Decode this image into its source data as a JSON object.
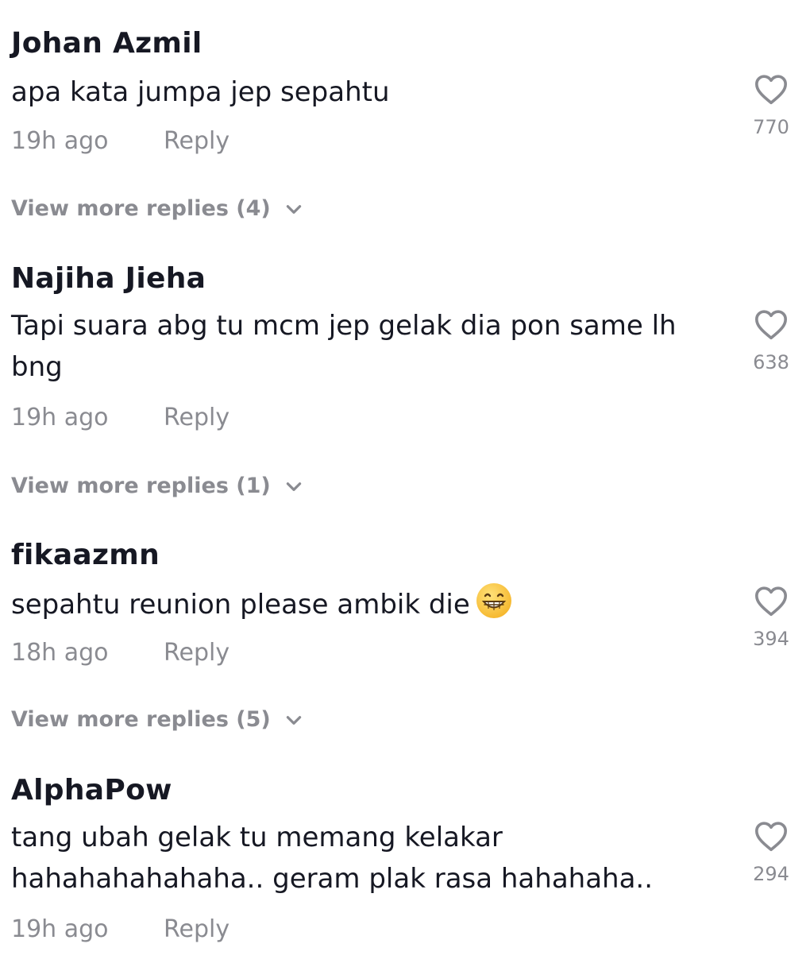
{
  "comments": [
    {
      "username": "Johan Azmil",
      "text": "apa kata jumpa jep sepahtu",
      "time": "19h ago",
      "reply_label": "Reply",
      "likes": "770",
      "view_more": "View more replies (4)"
    },
    {
      "username": "Najiha Jieha",
      "text": "Tapi suara abg tu mcm jep gelak dia pon same lh bng",
      "time": "19h ago",
      "reply_label": "Reply",
      "likes": "638",
      "view_more": "View more replies (1)"
    },
    {
      "username": "fikaazmn",
      "text": "sepahtu reunion please ambik die",
      "emoji": "grinning-face-emoji",
      "time": "18h ago",
      "reply_label": "Reply",
      "likes": "394",
      "view_more": "View more replies (5)"
    },
    {
      "username": "AlphaPow",
      "text": "tang ubah gelak tu memang kelakar hahahahahahaha.. geram plak rasa hahahaha..",
      "time": "19h ago",
      "reply_label": "Reply",
      "likes": "294"
    }
  ],
  "icons": {
    "like": "heart-outline-icon",
    "expand": "chevron-down-icon"
  },
  "colors": {
    "username": "#161823",
    "text": "#161823",
    "secondary": "#8a8b91",
    "background": "#ffffff"
  }
}
